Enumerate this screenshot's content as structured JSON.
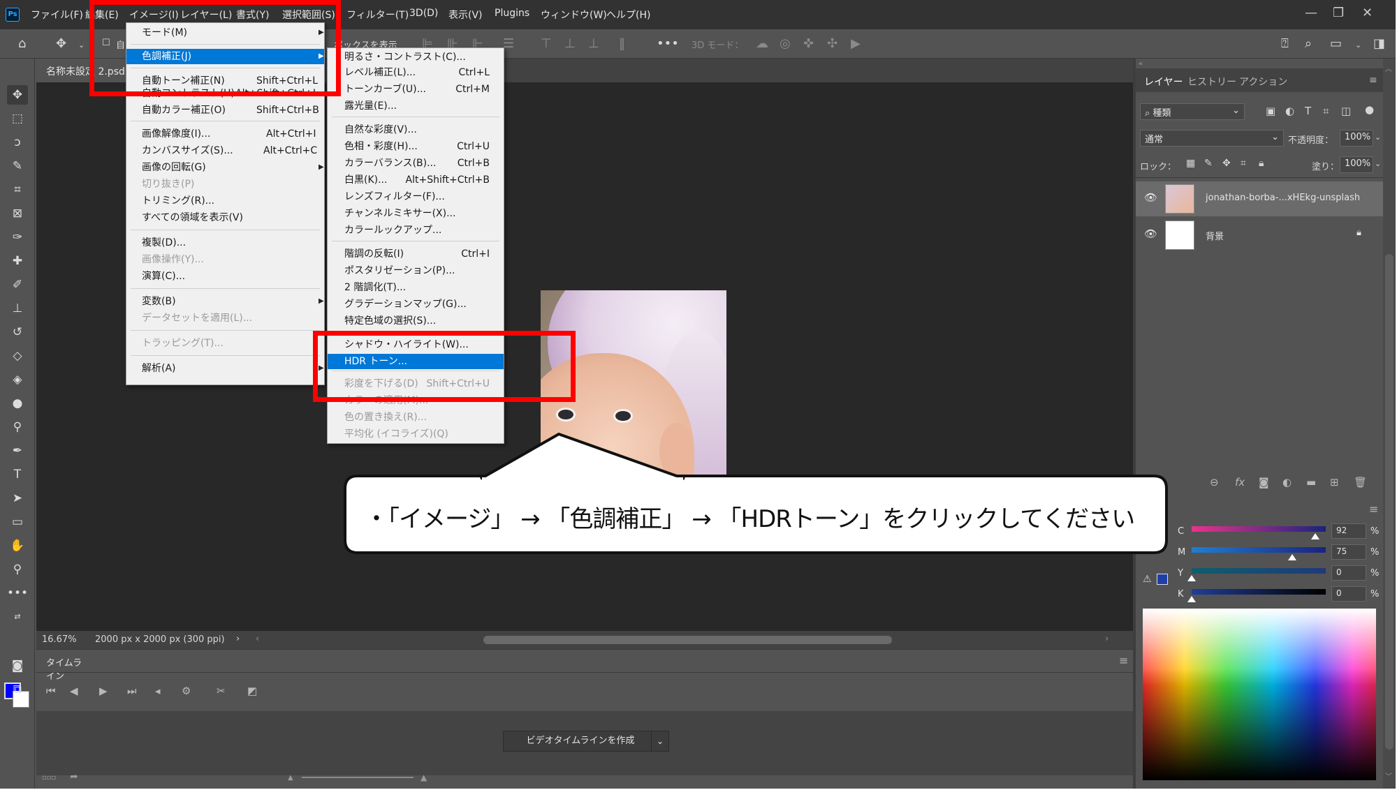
{
  "menubar": {
    "items": [
      "ファイル(F)",
      "編集(E)",
      "イメージ(I)",
      "レイヤー(L)",
      "書式(Y)",
      "選択範囲(S)",
      "フィルター(T)",
      "3D(D)",
      "表示(V)",
      "Plugins",
      "ウィンドウ(W)",
      "ヘルプ(H)"
    ]
  },
  "options": {
    "auto_select_label": "自",
    "transform_label": "ボックスを表示",
    "mode3d_label": "3D モード："
  },
  "document": {
    "tab_label": "名称未設定 2.psd"
  },
  "status": {
    "zoom": "16.67%",
    "doc_info": "2000 px x 2000 px (300 ppi)"
  },
  "timeline": {
    "tab_label": "タイムライン",
    "create_button": "ビデオタイムラインを作成"
  },
  "image_menu": {
    "items": [
      {
        "label": "モード(M)",
        "shortcut": "",
        "submenu": true,
        "disabled": false,
        "highlight": false
      },
      {
        "label": "色調補正(J)",
        "shortcut": "",
        "submenu": true,
        "disabled": false,
        "highlight": true
      },
      {
        "label": "自動トーン補正(N)",
        "shortcut": "Shift+Ctrl+L",
        "submenu": false,
        "disabled": false,
        "highlight": false
      },
      {
        "label": "自動コントラスト(U)",
        "shortcut": "Alt+Shift+Ctrl+L",
        "submenu": false,
        "disabled": false,
        "highlight": false
      },
      {
        "label": "自動カラー補正(O)",
        "shortcut": "Shift+Ctrl+B",
        "submenu": false,
        "disabled": false,
        "highlight": false
      },
      {
        "label": "画像解像度(I)...",
        "shortcut": "Alt+Ctrl+I",
        "submenu": false,
        "disabled": false,
        "highlight": false
      },
      {
        "label": "カンバスサイズ(S)...",
        "shortcut": "Alt+Ctrl+C",
        "submenu": false,
        "disabled": false,
        "highlight": false
      },
      {
        "label": "画像の回転(G)",
        "shortcut": "",
        "submenu": true,
        "disabled": false,
        "highlight": false
      },
      {
        "label": "切り抜き(P)",
        "shortcut": "",
        "submenu": false,
        "disabled": true,
        "highlight": false
      },
      {
        "label": "トリミング(R)...",
        "shortcut": "",
        "submenu": false,
        "disabled": false,
        "highlight": false
      },
      {
        "label": "すべての領域を表示(V)",
        "shortcut": "",
        "submenu": false,
        "disabled": false,
        "highlight": false
      },
      {
        "label": "複製(D)...",
        "shortcut": "",
        "submenu": false,
        "disabled": false,
        "highlight": false
      },
      {
        "label": "画像操作(Y)...",
        "shortcut": "",
        "submenu": false,
        "disabled": true,
        "highlight": false
      },
      {
        "label": "演算(C)...",
        "shortcut": "",
        "submenu": false,
        "disabled": false,
        "highlight": false
      },
      {
        "label": "変数(B)",
        "shortcut": "",
        "submenu": true,
        "disabled": false,
        "highlight": false
      },
      {
        "label": "データセットを適用(L)...",
        "shortcut": "",
        "submenu": false,
        "disabled": true,
        "highlight": false
      },
      {
        "label": "トラッピング(T)...",
        "shortcut": "",
        "submenu": false,
        "disabled": true,
        "highlight": false
      },
      {
        "label": "解析(A)",
        "shortcut": "",
        "submenu": true,
        "disabled": false,
        "highlight": false
      }
    ]
  },
  "adjust_menu": {
    "items": [
      {
        "label": "明るさ・コントラスト(C)...",
        "shortcut": "",
        "disabled": false,
        "highlight": false
      },
      {
        "label": "レベル補正(L)...",
        "shortcut": "Ctrl+L",
        "disabled": false,
        "highlight": false
      },
      {
        "label": "トーンカーブ(U)...",
        "shortcut": "Ctrl+M",
        "disabled": false,
        "highlight": false
      },
      {
        "label": "露光量(E)...",
        "shortcut": "",
        "disabled": false,
        "highlight": false
      },
      {
        "label": "自然な彩度(V)...",
        "shortcut": "",
        "disabled": false,
        "highlight": false
      },
      {
        "label": "色相・彩度(H)...",
        "shortcut": "Ctrl+U",
        "disabled": false,
        "highlight": false
      },
      {
        "label": "カラーバランス(B)...",
        "shortcut": "Ctrl+B",
        "disabled": false,
        "highlight": false
      },
      {
        "label": "白黒(K)...",
        "shortcut": "Alt+Shift+Ctrl+B",
        "disabled": false,
        "highlight": false
      },
      {
        "label": "レンズフィルター(F)...",
        "shortcut": "",
        "disabled": false,
        "highlight": false
      },
      {
        "label": "チャンネルミキサー(X)...",
        "shortcut": "",
        "disabled": false,
        "highlight": false
      },
      {
        "label": "カラールックアップ...",
        "shortcut": "",
        "disabled": false,
        "highlight": false
      },
      {
        "label": "階調の反転(I)",
        "shortcut": "Ctrl+I",
        "disabled": false,
        "highlight": false
      },
      {
        "label": "ポスタリゼーション(P)...",
        "shortcut": "",
        "disabled": false,
        "highlight": false
      },
      {
        "label": "2 階調化(T)...",
        "shortcut": "",
        "disabled": false,
        "highlight": false
      },
      {
        "label": "グラデーションマップ(G)...",
        "shortcut": "",
        "disabled": false,
        "highlight": false
      },
      {
        "label": "特定色域の選択(S)...",
        "shortcut": "",
        "disabled": false,
        "highlight": false
      },
      {
        "label": "シャドウ・ハイライト(W)...",
        "shortcut": "",
        "disabled": false,
        "highlight": false
      },
      {
        "label": "HDR トーン...",
        "shortcut": "",
        "disabled": false,
        "highlight": true
      },
      {
        "label": "彩度を下げる(D)",
        "shortcut": "Shift+Ctrl+U",
        "disabled": true,
        "highlight": false
      },
      {
        "label": "カラーの適用(M)...",
        "shortcut": "",
        "disabled": true,
        "highlight": false
      },
      {
        "label": "色の置き換え(R)...",
        "shortcut": "",
        "disabled": true,
        "highlight": false
      },
      {
        "label": "平均化 (イコライズ)(Q)",
        "shortcut": "",
        "disabled": true,
        "highlight": false
      }
    ]
  },
  "layers_panel": {
    "tabs": [
      "レイヤー",
      "ヒストリー",
      "アクション"
    ],
    "filter_kind": "種類",
    "blend_mode": "通常",
    "opacity_label": "不透明度：",
    "opacity_value": "100%",
    "lock_label": "ロック：",
    "fill_label": "塗り：",
    "fill_value": "100%",
    "layers": [
      {
        "name": "jonathan-borba-...xHEkg-unsplash",
        "selected": true
      },
      {
        "name": "背景",
        "selected": false
      }
    ]
  },
  "color_panel": {
    "channels": [
      {
        "label": "C",
        "value": "92",
        "unit": "%",
        "color_from": "#e9338c",
        "color_to": "#1a237e",
        "level": 0.92
      },
      {
        "label": "M",
        "value": "75",
        "unit": "%",
        "color_from": "#1f7fd1",
        "color_to": "#1a237e",
        "level": 0.75
      },
      {
        "label": "Y",
        "value": "0",
        "unit": "%",
        "color_from": "#0f5e6c",
        "color_to": "#1f3a7a",
        "level": 0.0
      },
      {
        "label": "K",
        "value": "0",
        "unit": "%",
        "color_from": "#1f3d9a",
        "color_to": "#000000",
        "level": 0.0
      }
    ]
  },
  "callout": {
    "text": "・「イメージ」 → 「色調補正」 → 「HDRトーン」をクリックしてください"
  },
  "colors": {
    "accent_highlight": "#0078d7",
    "red_box": "#ff0000",
    "foreground_color": "#0000ff"
  }
}
